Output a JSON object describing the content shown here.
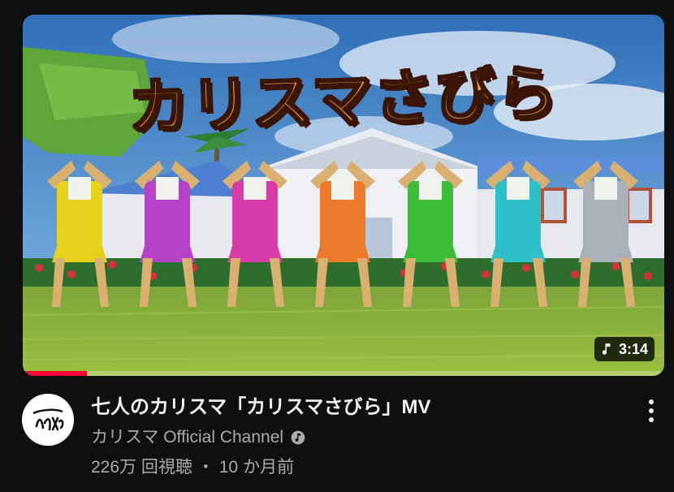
{
  "video": {
    "thumbnail_overlay_title": "カリスマさびら",
    "duration": "3:14",
    "duration_icon": "music-note-icon",
    "watch_progress": 0.1,
    "title": "七人のカリスマ「カリスマさびら」MV",
    "channel_name": "カリスマ Official Channel",
    "channel_badge_icon": "verified-artist-icon",
    "views": "226万 回視聴",
    "separator": "・",
    "uploaded": "10 か月前"
  },
  "avatar_logo_text": "カリスマ",
  "menu_icon": "more-vert-icon",
  "colors": {
    "background": "#0f0f0f",
    "title_text": "#f1f1f1",
    "secondary_text": "#aaaaaa",
    "progress": "#ff0033"
  },
  "figure_colors": [
    "#e6d21a",
    "#b640c8",
    "#d83ca8",
    "#ec7a2a",
    "#3bbd3a",
    "#2dc0c8",
    "#a9b0b8"
  ]
}
